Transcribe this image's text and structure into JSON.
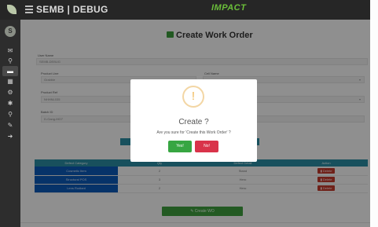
{
  "app": {
    "title": "SEMB | DEBUG",
    "brand": "IMPACT",
    "avatar_initial": "S"
  },
  "sidebar": {
    "items": [
      {
        "icon": "inbox-icon",
        "glyph": "✉"
      },
      {
        "icon": "search-icon",
        "glyph": "⚲"
      },
      {
        "icon": "card-icon",
        "glyph": "▬"
      },
      {
        "icon": "grid-icon",
        "glyph": "▦"
      },
      {
        "icon": "settings-icon",
        "glyph": "⚙"
      },
      {
        "icon": "gear-icon",
        "glyph": "✱"
      },
      {
        "icon": "search-icon",
        "glyph": "⚲"
      },
      {
        "icon": "wrench-icon",
        "glyph": "✎"
      },
      {
        "icon": "logout-icon",
        "glyph": "➜"
      }
    ]
  },
  "page": {
    "title": "Create Work Order"
  },
  "form": {
    "user_name_label": "User Name",
    "user_name_value": "SEMB-DEBUG",
    "product_line_label": "Product Line",
    "product_line_value": "Grabble",
    "cell_name_label": "Cell Name",
    "product_ref_label": "Product Ref",
    "product_ref_value": "NHHNL035",
    "batch_id_label": "Batch ID",
    "batch_id_value": "D-Gang-MO7"
  },
  "table": {
    "headers": [
      "Defect Category",
      "Qty",
      "Defect Detail",
      "Action"
    ],
    "rows": [
      {
        "category": "Cosmetic Item",
        "qty": "2",
        "detail": "Stand",
        "action": "Delete"
      },
      {
        "category": "Structural POS",
        "qty": "3",
        "detail": "Hero",
        "action": "Delete"
      },
      {
        "category": "Lens Rodiant",
        "qty": "2",
        "detail": "Hero",
        "action": "Delete"
      }
    ]
  },
  "actions": {
    "create_wo": "Create WO"
  },
  "dialog": {
    "icon": "!",
    "title": "Create ?",
    "message": "Are you sure for 'Create this Work Order' ?",
    "yes_label": "Yes!",
    "no_label": "No!"
  }
}
